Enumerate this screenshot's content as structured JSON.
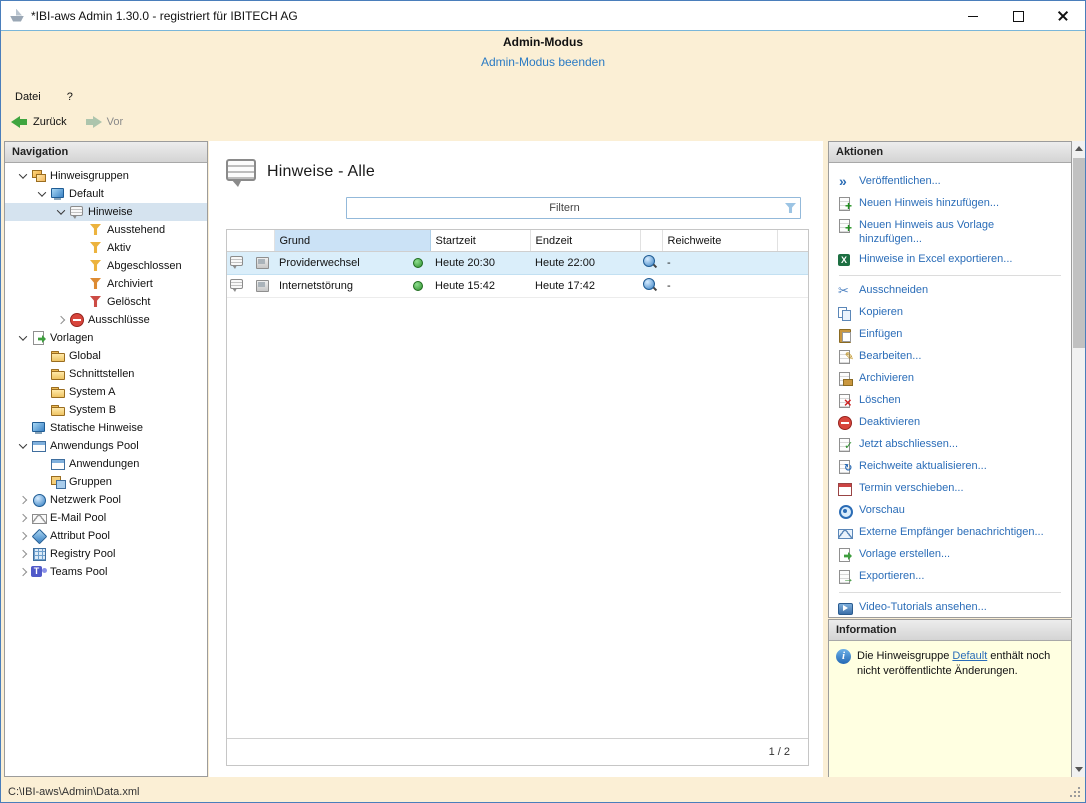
{
  "window": {
    "title": "*IBI-aws Admin 1.30.0 - registriert für IBITECH AG",
    "controls": [
      "minimize",
      "maximize",
      "close"
    ]
  },
  "banner": {
    "title": "Admin-Modus",
    "link": "Admin-Modus beenden"
  },
  "menubar": {
    "items": [
      {
        "label": "Datei"
      },
      {
        "label": "?"
      }
    ]
  },
  "toolbar": {
    "back": "Zurück",
    "forward": "Vor",
    "back_icon": "arrow-left-green",
    "forward_icon": "arrow-right-gray"
  },
  "navigation": {
    "header": "Navigation",
    "items": [
      {
        "label": "Hinweisgruppen",
        "icon": "package"
      },
      {
        "label": "Default",
        "icon": "monitor"
      },
      {
        "label": "Hinweise",
        "icon": "note",
        "selected": true
      },
      {
        "label": "Ausstehend",
        "icon": "funnel-y"
      },
      {
        "label": "Aktiv",
        "icon": "funnel-y"
      },
      {
        "label": "Abgeschlossen",
        "icon": "funnel-y"
      },
      {
        "label": "Archiviert",
        "icon": "funnel-o"
      },
      {
        "label": "Gelöscht",
        "icon": "funnel-r"
      },
      {
        "label": "Ausschlüsse",
        "icon": "exclude"
      },
      {
        "label": "Vorlagen",
        "icon": "template"
      },
      {
        "label": "Global",
        "icon": "folder"
      },
      {
        "label": "Schnittstellen",
        "icon": "folder"
      },
      {
        "label": "System A",
        "icon": "folder"
      },
      {
        "label": "System B",
        "icon": "folder"
      },
      {
        "label": "Statische Hinweise",
        "icon": "monitor"
      },
      {
        "label": "Anwendungs Pool",
        "icon": "window"
      },
      {
        "label": "Anwendungen",
        "icon": "window"
      },
      {
        "label": "Gruppen",
        "icon": "group"
      },
      {
        "label": "Netzwerk Pool",
        "icon": "network"
      },
      {
        "label": "E-Mail Pool",
        "icon": "mail"
      },
      {
        "label": "Attribut Pool",
        "icon": "attribute"
      },
      {
        "label": "Registry Pool",
        "icon": "registry"
      },
      {
        "label": "Teams Pool",
        "icon": "teams"
      }
    ]
  },
  "content": {
    "title": "Hinweise - Alle",
    "title_icon": "note",
    "filter": {
      "placeholder": "Filtern",
      "icon": "funnel-blue"
    },
    "table": {
      "headers": {
        "grund": "Grund",
        "startzeit": "Startzeit",
        "endzeit": "Endzeit",
        "reichweite": "Reichweite"
      },
      "rows": [
        {
          "type_icon": "note",
          "app_icon": "graybox",
          "grund": "Providerwechsel",
          "status_icon": "status-green",
          "startzeit": "Heute 20:30",
          "endzeit": "Heute 22:00",
          "reichweite_icon": "globe",
          "reichweite": "-",
          "selected": true
        },
        {
          "type_icon": "note",
          "app_icon": "graybox",
          "grund": "Internetstörung",
          "status_icon": "status-green",
          "startzeit": "Heute 15:42",
          "endzeit": "Heute 17:42",
          "reichweite_icon": "globe",
          "reichweite": "-",
          "selected": false
        }
      ]
    },
    "pager": "1 / 2"
  },
  "actions": {
    "header": "Aktionen",
    "items": [
      {
        "label": "Veröffentlichen...",
        "icon": "publish"
      },
      {
        "label": "Neuen Hinweis hinzufügen...",
        "icon": "add"
      },
      {
        "label": "Neuen Hinweis aus Vorlage hinzufügen...",
        "icon": "add-template"
      },
      {
        "label": "Hinweise in Excel exportieren...",
        "icon": "excel"
      },
      {
        "label": "Ausschneiden",
        "icon": "cut"
      },
      {
        "label": "Kopieren",
        "icon": "copy"
      },
      {
        "label": "Einfügen",
        "icon": "paste"
      },
      {
        "label": "Bearbeiten...",
        "icon": "edit"
      },
      {
        "label": "Archivieren",
        "icon": "archive"
      },
      {
        "label": "Löschen",
        "icon": "delete"
      },
      {
        "label": "Deaktivieren",
        "icon": "deactivate"
      },
      {
        "label": "Jetzt abschliessen...",
        "icon": "finish"
      },
      {
        "label": "Reichweite aktualisieren...",
        "icon": "refresh"
      },
      {
        "label": "Termin verschieben...",
        "icon": "reschedule"
      },
      {
        "label": "Vorschau",
        "icon": "preview"
      },
      {
        "label": "Externe Empfänger benachrichtigen...",
        "icon": "notify"
      },
      {
        "label": "Vorlage erstellen...",
        "icon": "template"
      },
      {
        "label": "Exportieren...",
        "icon": "export"
      },
      {
        "label": "Video-Tutorials ansehen...",
        "icon": "video"
      }
    ]
  },
  "information": {
    "header": "Information",
    "text_before": "Die Hinweisgruppe ",
    "link": "Default",
    "text_after": " enthält noch nicht veröffentlichte Änderungen."
  },
  "statusbar": {
    "path": "C:\\IBI-aws\\Admin\\Data.xml"
  },
  "colors": {
    "accent_link": "#2b6db8",
    "banner_bg": "#fbefd5",
    "row_selection": "#daeefa",
    "tree_selection": "#d5e3ef",
    "sorted_header": "#cbe2f6",
    "info_bg": "#ffffe1"
  }
}
